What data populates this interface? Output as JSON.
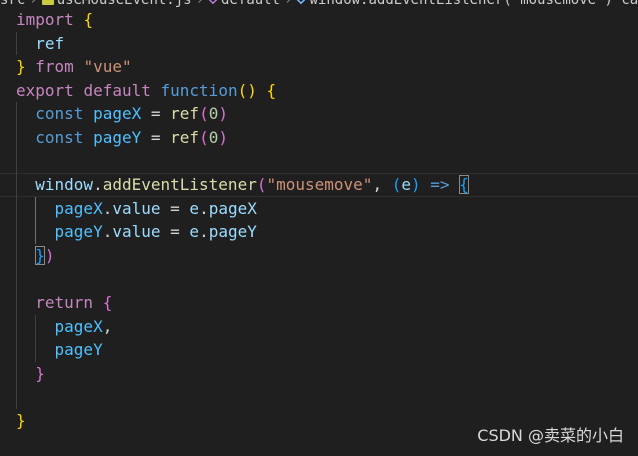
{
  "breadcrumb": {
    "folder": "src",
    "file": "useMouseEvent.js",
    "symbol": "default",
    "call": "window.addEventListener('mousemove') callback"
  },
  "code": {
    "lines": [
      [
        [
          "kwc",
          "import"
        ],
        [
          "plain",
          " "
        ],
        [
          "p1",
          "{"
        ]
      ],
      [
        [
          "plain",
          "  "
        ],
        [
          "var",
          "ref"
        ]
      ],
      [
        [
          "p1",
          "}"
        ],
        [
          "plain",
          " "
        ],
        [
          "kwc",
          "from"
        ],
        [
          "plain",
          " "
        ],
        [
          "str",
          "\"vue\""
        ]
      ],
      [
        [
          "kwc",
          "export"
        ],
        [
          "plain",
          " "
        ],
        [
          "kwc",
          "default"
        ],
        [
          "plain",
          " "
        ],
        [
          "kw",
          "function"
        ],
        [
          "p1",
          "()"
        ],
        [
          "plain",
          " "
        ],
        [
          "p1",
          "{"
        ]
      ],
      [
        [
          "plain",
          "  "
        ],
        [
          "kw",
          "const"
        ],
        [
          "plain",
          " "
        ],
        [
          "cst",
          "pageX"
        ],
        [
          "plain",
          " = "
        ],
        [
          "fn",
          "ref"
        ],
        [
          "p2",
          "("
        ],
        [
          "num",
          "0"
        ],
        [
          "p2",
          ")"
        ]
      ],
      [
        [
          "plain",
          "  "
        ],
        [
          "kw",
          "const"
        ],
        [
          "plain",
          " "
        ],
        [
          "cst",
          "pageY"
        ],
        [
          "plain",
          " = "
        ],
        [
          "fn",
          "ref"
        ],
        [
          "p2",
          "("
        ],
        [
          "num",
          "0"
        ],
        [
          "p2",
          ")"
        ]
      ],
      [],
      [
        [
          "plain",
          "  "
        ],
        [
          "var",
          "window"
        ],
        [
          "plain",
          "."
        ],
        [
          "fn",
          "addEventListener"
        ],
        [
          "p2",
          "("
        ],
        [
          "str",
          "\"mousemove\""
        ],
        [
          "plain",
          ", "
        ],
        [
          "p3",
          "("
        ],
        [
          "var",
          "e"
        ],
        [
          "p3",
          ")"
        ],
        [
          "plain",
          " "
        ],
        [
          "kw",
          "=>"
        ],
        [
          "plain",
          " "
        ],
        [
          "p3 bm",
          "{"
        ]
      ],
      [
        [
          "plain",
          "    "
        ],
        [
          "cst",
          "pageX"
        ],
        [
          "plain",
          "."
        ],
        [
          "var",
          "value"
        ],
        [
          "plain",
          " = "
        ],
        [
          "var",
          "e"
        ],
        [
          "plain",
          "."
        ],
        [
          "var",
          "pageX"
        ]
      ],
      [
        [
          "plain",
          "    "
        ],
        [
          "cst",
          "pageY"
        ],
        [
          "plain",
          "."
        ],
        [
          "var",
          "value"
        ],
        [
          "plain",
          " = "
        ],
        [
          "var",
          "e"
        ],
        [
          "plain",
          "."
        ],
        [
          "var",
          "pageY"
        ]
      ],
      [
        [
          "plain",
          "  "
        ],
        [
          "p3 bm",
          "}"
        ],
        [
          "p2",
          ")"
        ]
      ],
      [],
      [
        [
          "plain",
          "  "
        ],
        [
          "kwc",
          "return"
        ],
        [
          "plain",
          " "
        ],
        [
          "p2",
          "{"
        ]
      ],
      [
        [
          "plain",
          "    "
        ],
        [
          "cst",
          "pageX"
        ],
        [
          "plain",
          ","
        ]
      ],
      [
        [
          "plain",
          "    "
        ],
        [
          "cst",
          "pageY"
        ]
      ],
      [
        [
          "plain",
          "  "
        ],
        [
          "p2",
          "}"
        ]
      ],
      [],
      [
        [
          "p1",
          "}"
        ]
      ]
    ]
  },
  "watermark": "CSDN @卖菜的小白"
}
